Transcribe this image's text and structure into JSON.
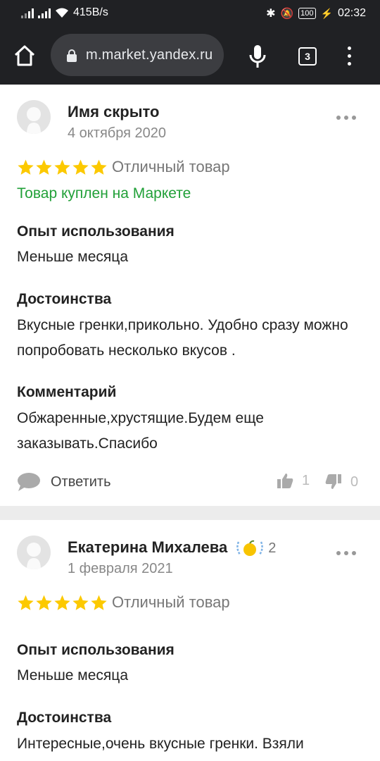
{
  "status_bar": {
    "network_speed": "415B/s",
    "battery": "100",
    "time": "02:32"
  },
  "browser": {
    "url": "m.market.yandex.ru",
    "tab_count": "3"
  },
  "reviews": [
    {
      "author": "Имя скрыто",
      "date": "4 октября 2020",
      "rating": 5,
      "rating_text": "Отличный товар",
      "bought_label": "Товар куплен на Маркете",
      "sections": [
        {
          "title": "Опыт использования",
          "text": "Меньше месяца"
        },
        {
          "title": "Достоинства",
          "text": "Вкусные гренки,прикольно. Удобно сразу можно попробовать несколько вкусов ."
        },
        {
          "title": "Комментарий",
          "text": "Обжаренные,хрустящие.Будем еще заказывать.Спасибо"
        }
      ],
      "reply_label": "Ответить",
      "likes": "1",
      "dislikes": "0"
    },
    {
      "author": "Екатерина Михалева",
      "badge_count": "2",
      "date": "1 февраля 2021",
      "rating": 5,
      "rating_text": "Отличный товар",
      "sections": [
        {
          "title": "Опыт использования",
          "text": "Меньше месяца"
        },
        {
          "title": "Достоинства",
          "text": "Интересные,очень вкусные гренки. Взяли"
        }
      ]
    }
  ],
  "colors": {
    "star": "#fcc900",
    "bought": "#21a038",
    "chrome_bg": "#202124"
  }
}
